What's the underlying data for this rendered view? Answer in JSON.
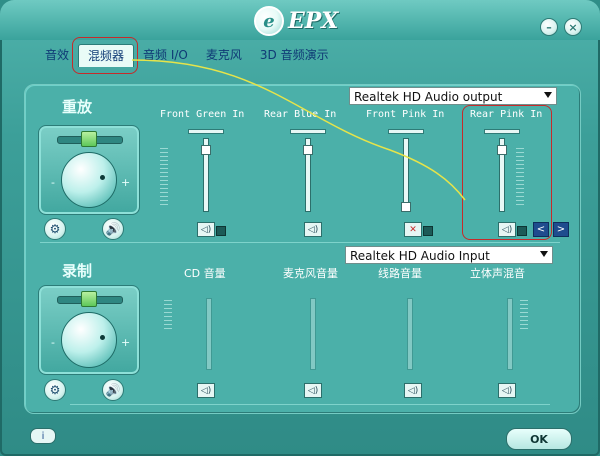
{
  "app": {
    "logo_letter": "e",
    "logo_text": "EPX",
    "minimize_icon": "minimize-icon",
    "close_icon": "close-icon"
  },
  "tabs": [
    {
      "label": "音效"
    },
    {
      "label": "混频器",
      "active": true
    },
    {
      "label": "音频 I/O"
    },
    {
      "label": "麦克风"
    },
    {
      "label": "3D 音频演示"
    }
  ],
  "playback": {
    "title": "重放",
    "device_select": "Realtek HD Audio output",
    "channels": [
      {
        "label": "Front Green In",
        "level": 0.85
      },
      {
        "label": "Rear Blue In",
        "level": 0.85
      },
      {
        "label": "Front Pink In",
        "level": 0.05,
        "muted": true
      },
      {
        "label": "Rear Pink In",
        "level": 0.85
      }
    ],
    "knob_minus": "-",
    "knob_plus": "+"
  },
  "record": {
    "title": "录制",
    "device_select": "Realtek HD Audio Input",
    "channels": [
      {
        "label": "CD 音量"
      },
      {
        "label": "麦克风音量"
      },
      {
        "label": "线路音量"
      },
      {
        "label": "立体声混音"
      }
    ],
    "knob_minus": "-",
    "knob_plus": "+"
  },
  "footer": {
    "ok_label": "OK",
    "info_label": "i"
  },
  "colors": {
    "highlight": "#c62a2a",
    "accent": "#1f4c8e",
    "panel": "#4bb0a9"
  }
}
